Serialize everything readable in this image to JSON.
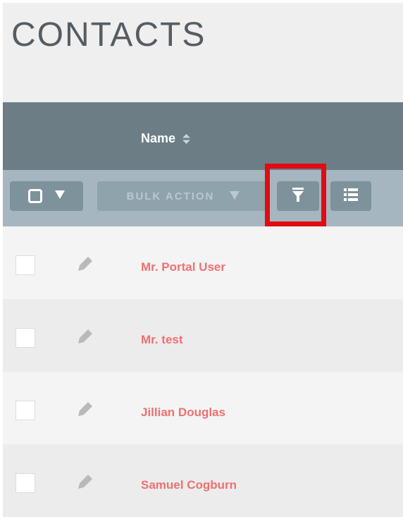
{
  "header": {
    "title": "CONTACTS"
  },
  "table": {
    "columns": [
      {
        "label": "Name",
        "sortable": true,
        "sort_icon": "sort-icon"
      }
    ]
  },
  "toolbar": {
    "select_icon": "checkbox-icon",
    "select_dropdown_icon": "caret-down-icon",
    "bulk_action_label": "BULK ACTION",
    "bulk_action_dropdown_icon": "caret-down-icon",
    "filter_icon": "filter-icon",
    "column_chooser_icon": "list-icon"
  },
  "rows": [
    {
      "name": "Mr. Portal User",
      "edit_icon": "pencil-icon"
    },
    {
      "name": "Mr. test",
      "edit_icon": "pencil-icon"
    },
    {
      "name": "Jillian Douglas",
      "edit_icon": "pencil-icon"
    },
    {
      "name": "Samuel Cogburn",
      "edit_icon": "pencil-icon"
    }
  ],
  "colors": {
    "header_bg": "#6c7d86",
    "toolbar_bg": "#a5b6c0",
    "button_bg": "#7e929c",
    "link": "#f07070",
    "highlight": "#e00b13"
  }
}
